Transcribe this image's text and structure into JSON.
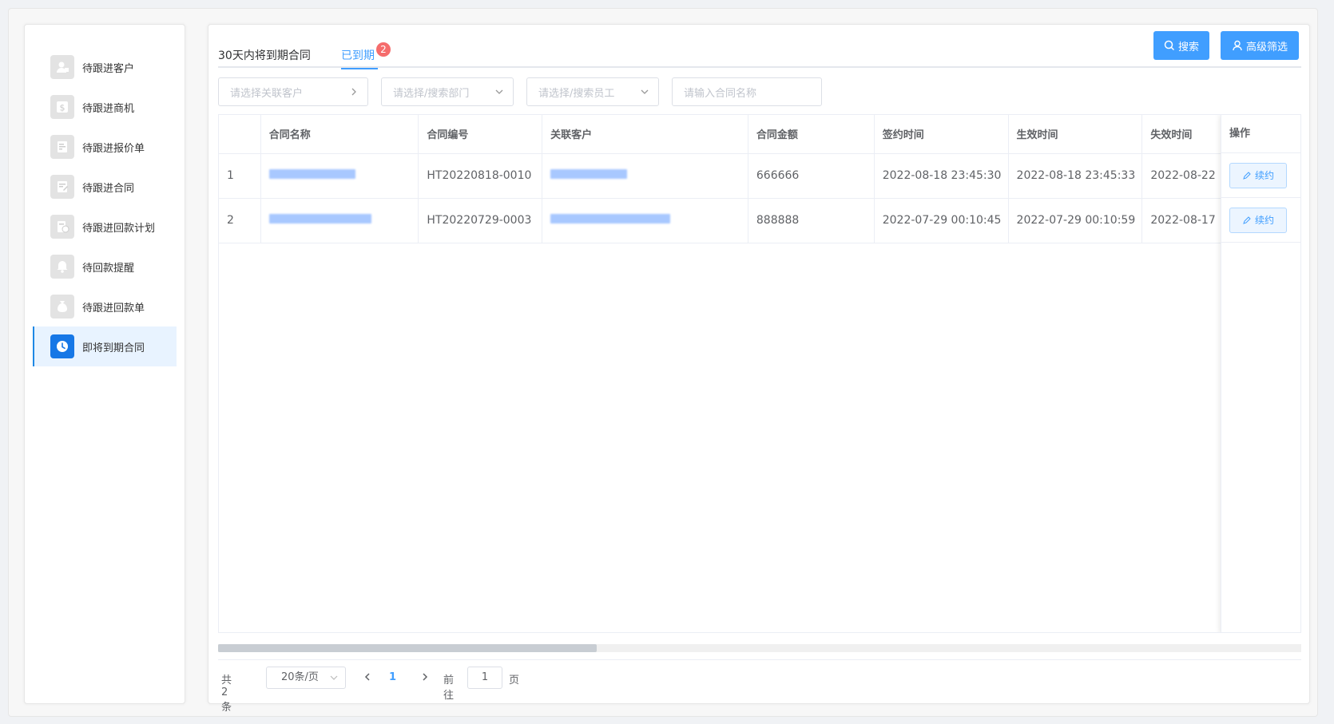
{
  "sidebar": {
    "items": [
      {
        "label": "待跟进客户",
        "icon": "customer-icon",
        "active": false
      },
      {
        "label": "待跟进商机",
        "icon": "dollar-icon",
        "active": false
      },
      {
        "label": "待跟进报价单",
        "icon": "quote-document-icon",
        "active": false
      },
      {
        "label": "待跟进合同",
        "icon": "contract-icon",
        "active": false
      },
      {
        "label": "待跟进回款计划",
        "icon": "payment-plan-icon",
        "active": false
      },
      {
        "label": "待回款提醒",
        "icon": "bell-icon",
        "active": false
      },
      {
        "label": "待跟进回款单",
        "icon": "money-bag-icon",
        "active": false
      },
      {
        "label": "即将到期合同",
        "icon": "clock-icon",
        "active": true
      }
    ]
  },
  "tabs": [
    {
      "label": "30天内将到期合同",
      "active": false
    },
    {
      "label": "已到期",
      "active": true,
      "badge": "2"
    }
  ],
  "toolbar": {
    "search_label": "搜索",
    "advanced_filter_label": "高级筛选"
  },
  "filters": {
    "customer_placeholder": "请选择关联客户",
    "department_placeholder": "请选择/搜索部门",
    "employee_placeholder": "请选择/搜索员工",
    "contract_name_placeholder": "请输入合同名称"
  },
  "table": {
    "columns": [
      "合同名称",
      "合同编号",
      "关联客户",
      "合同金额",
      "签约时间",
      "生效时间",
      "失效时间",
      "操作"
    ],
    "rows": [
      {
        "index": "1",
        "contract_no": "HT20220818-0010",
        "amount": "666666",
        "signed": "2022-08-18 23:45:30",
        "effective": "2022-08-18 23:45:33",
        "expire": "2022-08-22",
        "action": "续约"
      },
      {
        "index": "2",
        "contract_no": "HT20220729-0003",
        "amount": "888888",
        "signed": "2022-07-29 00:10:45",
        "effective": "2022-07-29 00:10:59",
        "expire": "2022-08-17",
        "action": "续约"
      }
    ]
  },
  "pagination": {
    "total_text": "共 2 条",
    "page_size": "20条/页",
    "current_page": "1",
    "goto_label": "前往",
    "goto_value": "1",
    "page_unit": "页"
  },
  "colors": {
    "accent": "#409eff",
    "badge": "#f56c6c",
    "active_bg": "#e8f3ff"
  }
}
